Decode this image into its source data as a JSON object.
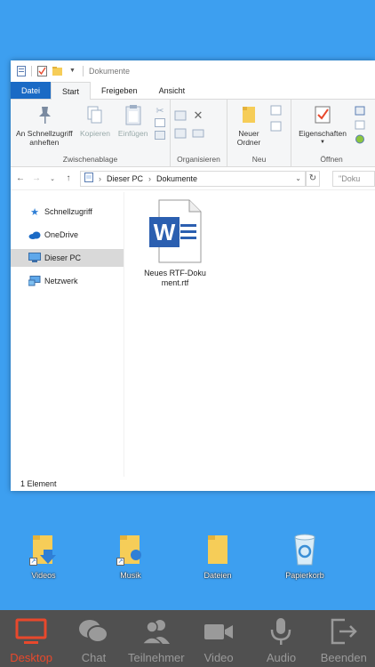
{
  "window": {
    "title": "Dokumente",
    "ribbon_tabs": [
      "Datei",
      "Start",
      "Freigeben",
      "Ansicht"
    ],
    "groups": {
      "clipboard": {
        "label": "Zwischenablage",
        "pin_label": "An Schnellzugriff anheften",
        "copy_label": "Kopieren",
        "paste_label": "Einfügen"
      },
      "organize": {
        "label": "Organisieren"
      },
      "new": {
        "label": "Neu",
        "new_folder_label": "Neuer Ordner"
      },
      "open": {
        "label": "Öffnen",
        "properties_label": "Eigenschaften"
      }
    },
    "address": {
      "crumbs": [
        "Dieser PC",
        "Dokumente"
      ],
      "search_placeholder": "\"Doku"
    },
    "nav_items": [
      {
        "label": "Schnellzugriff",
        "icon": "star-icon"
      },
      {
        "label": "OneDrive",
        "icon": "cloud-icon"
      },
      {
        "label": "Dieser PC",
        "icon": "pc-icon",
        "selected": true
      },
      {
        "label": "Netzwerk",
        "icon": "network-icon"
      }
    ],
    "files": [
      {
        "name": "Neues RTF-Dokument.rtf",
        "icon": "word-document-icon"
      }
    ],
    "status": "1 Element"
  },
  "desktop_icons": [
    {
      "label": "Videos",
      "icon": "videos-folder-icon"
    },
    {
      "label": "Musik",
      "icon": "music-folder-icon"
    },
    {
      "label": "Dateien",
      "icon": "folder-icon"
    },
    {
      "label": "Papierkorb",
      "icon": "recycle-bin-icon"
    }
  ],
  "toolbar": {
    "items": [
      {
        "label": "Desktop",
        "icon": "desktop-icon",
        "active": true
      },
      {
        "label": "Chat",
        "icon": "chat-icon"
      },
      {
        "label": "Teilnehmer",
        "icon": "participants-icon"
      },
      {
        "label": "Video",
        "icon": "video-camera-icon"
      },
      {
        "label": "Audio",
        "icon": "microphone-icon"
      },
      {
        "label": "Beenden",
        "icon": "exit-icon"
      }
    ],
    "active_color": "#e8482c",
    "inactive_color": "#9a9a9a"
  },
  "colors": {
    "desktop_bg": "#3d9ff0",
    "file_tab": "#1a6ac5",
    "toolbar_bg": "#505050"
  }
}
